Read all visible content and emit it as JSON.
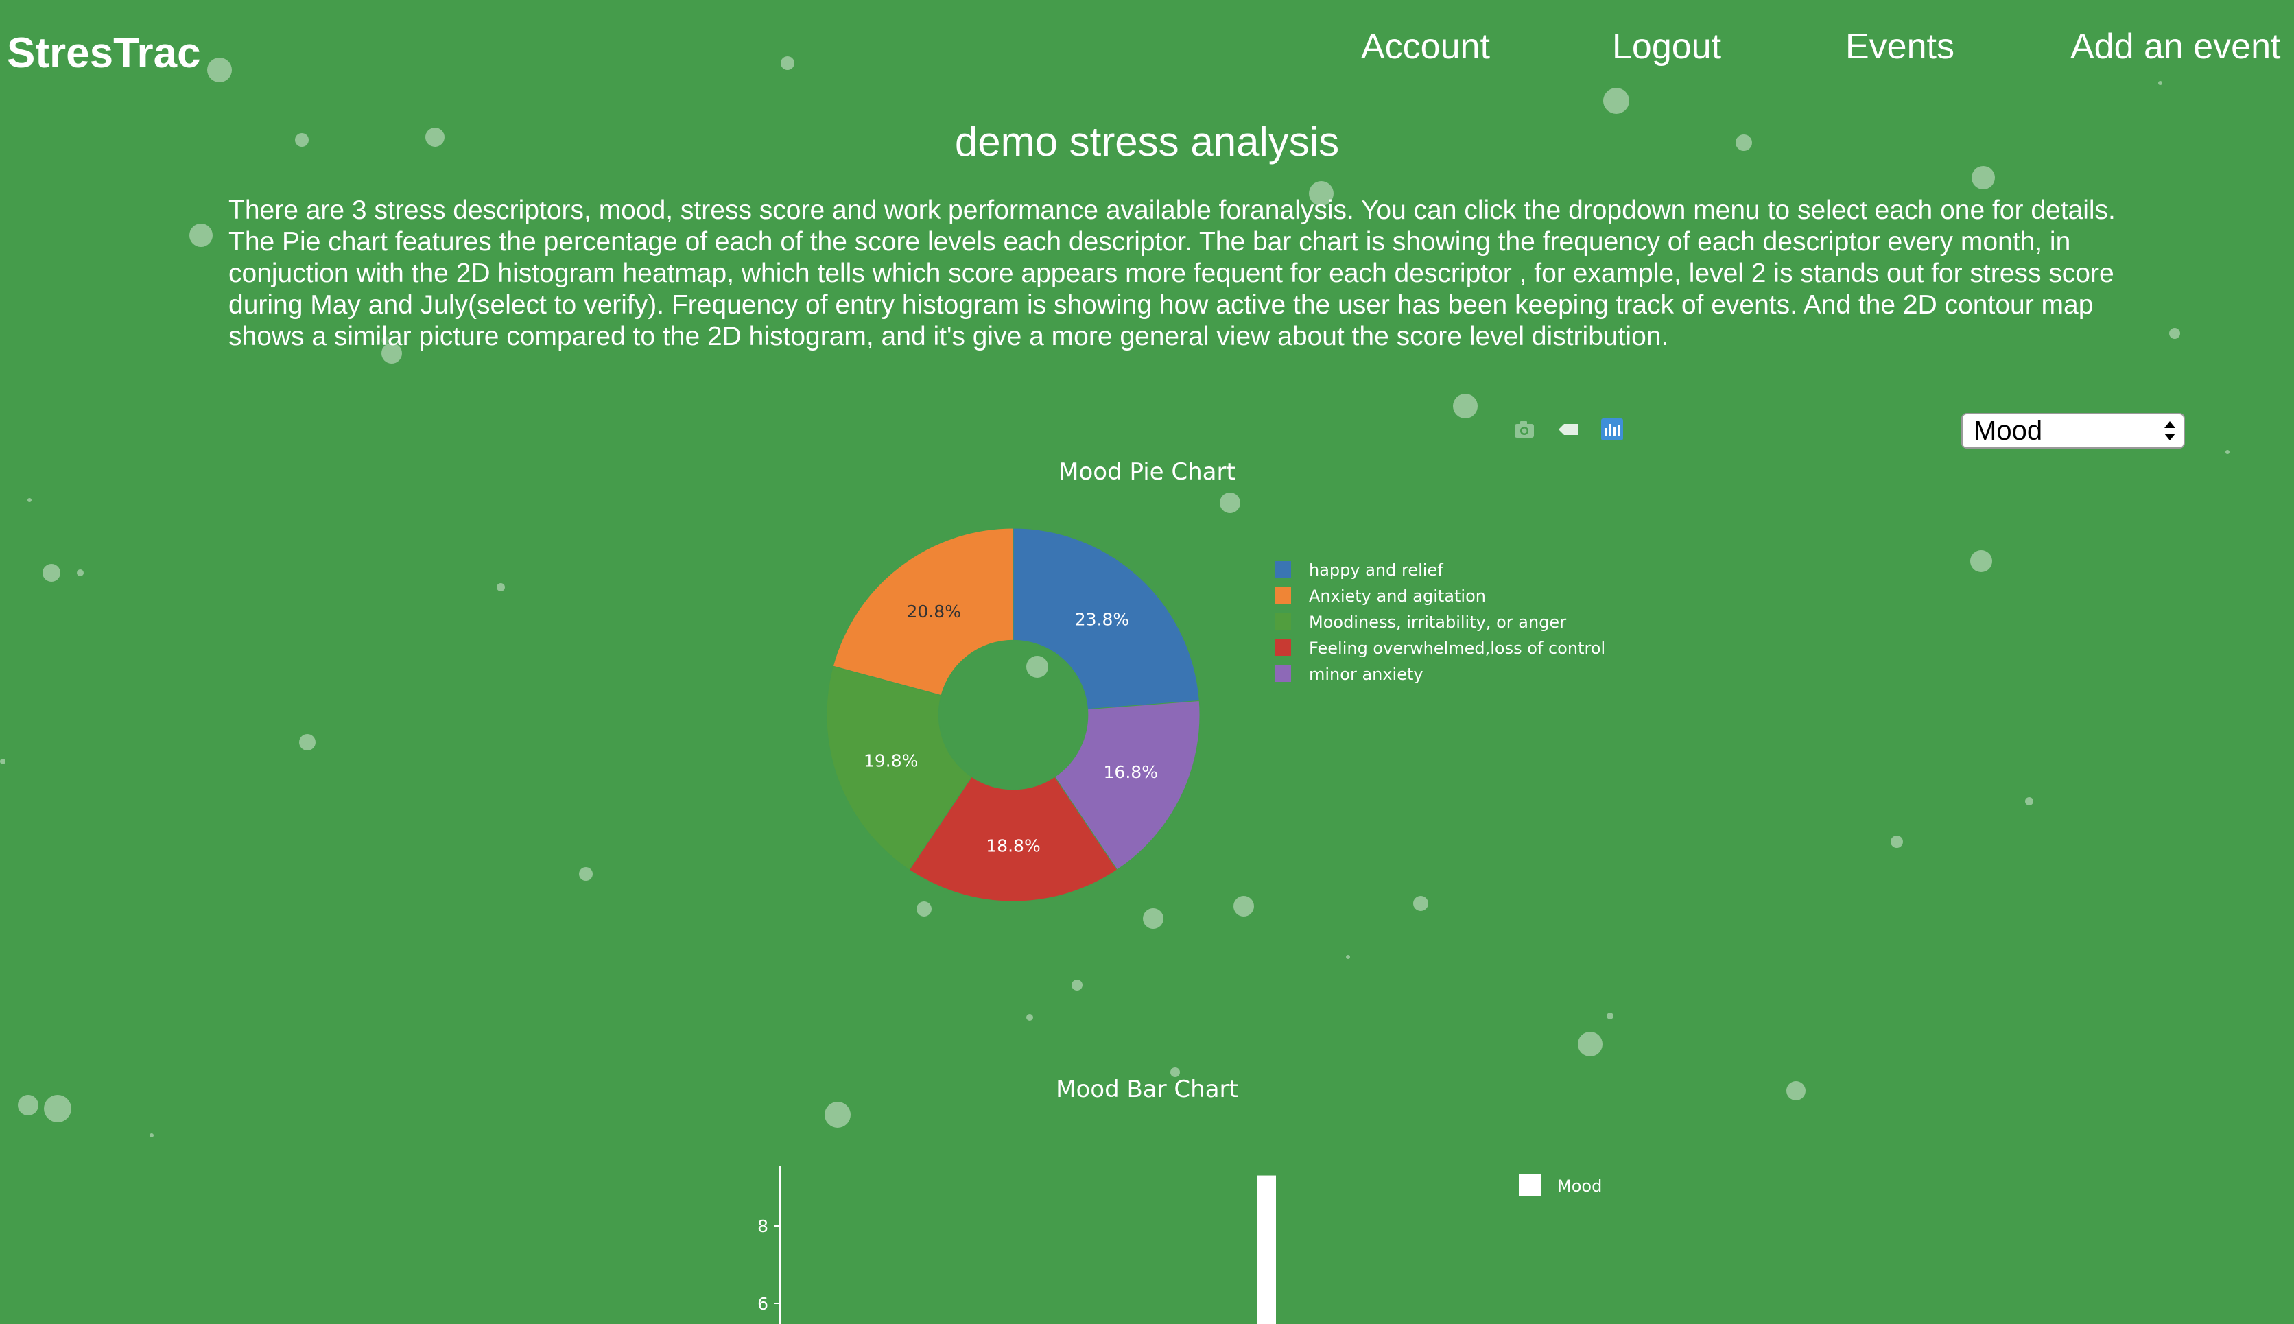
{
  "nav": {
    "brand": "StresTrac",
    "items": [
      {
        "id": "account",
        "label": "Account"
      },
      {
        "id": "logout",
        "label": "Logout"
      },
      {
        "id": "events",
        "label": "Events"
      },
      {
        "id": "add-event",
        "label": "Add an event"
      }
    ]
  },
  "page": {
    "title": "demo stress analysis",
    "description": "There are 3 stress descriptors, mood, stress score and work performance available foranalysis. You can click the dropdown menu to select each one for details. The Pie chart features the percentage of each of the score levels each descriptor. The bar chart is showing the frequency of each descriptor every month, in conjuction with the 2D histogram heatmap, which tells which score appears more fequent for each descriptor , for example, level 2 is stands out for stress score during May and July(select to verify). Frequency of entry histogram is showing how active the user has been keeping track of events. And the 2D contour map shows a similar picture compared to the 2D histogram, and it's give a more general view about the score level distribution."
  },
  "modebar": [
    {
      "id": "camera",
      "icon": "camera-icon"
    },
    {
      "id": "hover",
      "icon": "tag-icon"
    },
    {
      "id": "plotly",
      "icon": "plotly-logo-icon"
    }
  ],
  "dropdown": {
    "selected": "Mood",
    "icon": "updown-arrows-icon"
  },
  "colors": {
    "background": "#459c4b",
    "slice_1": "#3a75b3",
    "slice_2": "#ef8536",
    "slice_3": "#519e3e",
    "slice_4": "#c83a32",
    "slice_5": "#8d69b7"
  },
  "chart_data": [
    {
      "type": "pie",
      "title": "Mood Pie Chart",
      "hole": 0.4,
      "labels": [
        "happy and relief",
        "Anxiety and agitation",
        "Moodiness, irritability, or anger",
        "Feeling overwhelmed,loss of control",
        "minor anxiety"
      ],
      "values": [
        23.8,
        20.8,
        19.8,
        18.8,
        16.8
      ],
      "value_labels": [
        "23.8%",
        "20.8%",
        "19.8%",
        "18.8%",
        "16.8%"
      ],
      "colors": [
        "#3a75b3",
        "#ef8536",
        "#519e3e",
        "#c83a32",
        "#8d69b7"
      ],
      "legend_placement": "right"
    },
    {
      "type": "bar",
      "title": "Mood Bar Chart",
      "series": [
        {
          "name": "Mood",
          "values": [
            9.3
          ]
        }
      ],
      "y_ticks": [
        "8",
        "6"
      ],
      "legend_placement": "top-right",
      "note": "partially visible"
    }
  ]
}
